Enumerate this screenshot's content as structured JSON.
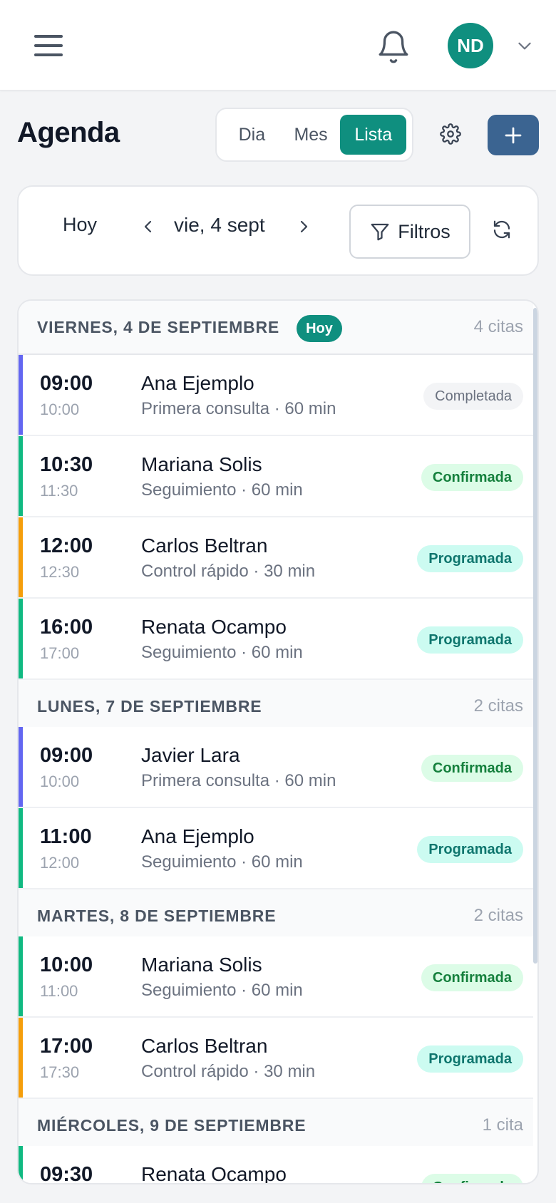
{
  "header": {
    "avatar_initials": "ND",
    "colors": {
      "accent": "#0f8f7f",
      "primary_button": "#3b6491"
    }
  },
  "toolbar": {
    "title": "Agenda",
    "views": [
      "Dia",
      "Mes",
      "Lista"
    ],
    "active_view": "Lista",
    "add_icon": "plus-icon",
    "settings_icon": "gear-icon"
  },
  "navigator": {
    "today_label": "Hoy",
    "date_label": "vie, 4 sept",
    "filters_label": "Filtros"
  },
  "groups": [
    {
      "title": "VIERNES, 4 DE SEPTIEMBRE",
      "today_badge": "Hoy",
      "count": "4 citas",
      "appointments": [
        {
          "start": "09:00",
          "end": "10:00",
          "name": "Ana Ejemplo",
          "detail": "Primera consulta · 60 min",
          "status": "Completada",
          "color": "#6366f1"
        },
        {
          "start": "10:30",
          "end": "11:30",
          "name": "Mariana Solis",
          "detail": "Seguimiento · 60 min",
          "status": "Confirmada",
          "color": "#10b981"
        },
        {
          "start": "12:00",
          "end": "12:30",
          "name": "Carlos Beltran",
          "detail": "Control rápido · 30 min",
          "status": "Programada",
          "color": "#f59e0b"
        },
        {
          "start": "16:00",
          "end": "17:00",
          "name": "Renata Ocampo",
          "detail": "Seguimiento · 60 min",
          "status": "Programada",
          "color": "#10b981"
        }
      ]
    },
    {
      "title": "LUNES, 7 DE SEPTIEMBRE",
      "count": "2 citas",
      "appointments": [
        {
          "start": "09:00",
          "end": "10:00",
          "name": "Javier Lara",
          "detail": "Primera consulta · 60 min",
          "status": "Confirmada",
          "color": "#6366f1"
        },
        {
          "start": "11:00",
          "end": "12:00",
          "name": "Ana Ejemplo",
          "detail": "Seguimiento · 60 min",
          "status": "Programada",
          "color": "#10b981"
        }
      ]
    },
    {
      "title": "MARTES, 8 DE SEPTIEMBRE",
      "count": "2 citas",
      "appointments": [
        {
          "start": "10:00",
          "end": "11:00",
          "name": "Mariana Solis",
          "detail": "Seguimiento · 60 min",
          "status": "Confirmada",
          "color": "#10b981"
        },
        {
          "start": "17:00",
          "end": "17:30",
          "name": "Carlos Beltran",
          "detail": "Control rápido · 30 min",
          "status": "Programada",
          "color": "#f59e0b"
        }
      ]
    },
    {
      "title": "MIÉRCOLES, 9 DE SEPTIEMBRE",
      "count": "1 cita",
      "appointments": [
        {
          "start": "09:30",
          "name": "Renata Ocampo",
          "status": "Confirmada",
          "color": "#10b981"
        }
      ]
    }
  ]
}
